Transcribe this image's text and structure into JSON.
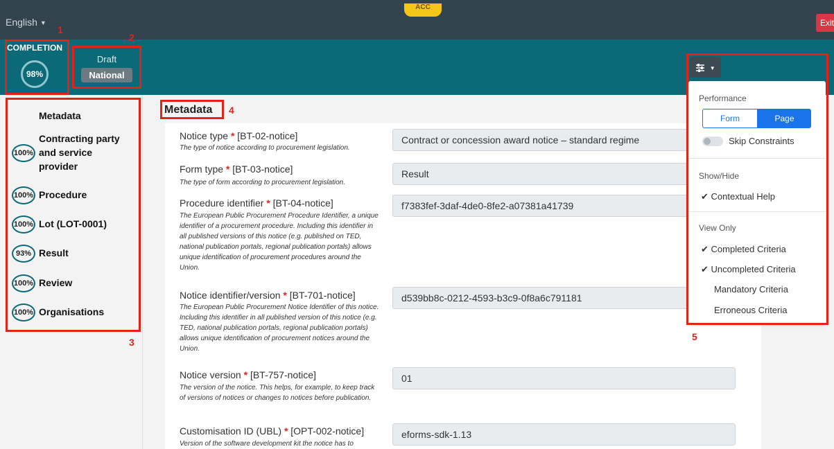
{
  "topbar": {
    "language": "English",
    "env_badge": "ACC",
    "exit_label": "Exit"
  },
  "header": {
    "completion_label": "COMPLETION",
    "completion_percent": "98%",
    "status": "Draft",
    "scope": "National"
  },
  "sections": [
    {
      "label": "Metadata",
      "percent": ""
    },
    {
      "label": "Contracting party and service provider",
      "percent": "100%"
    },
    {
      "label": "Procedure",
      "percent": "100%"
    },
    {
      "label": "Lot (LOT-0001)",
      "percent": "100%"
    },
    {
      "label": "Result",
      "percent": "93%"
    },
    {
      "label": "Review",
      "percent": "100%"
    },
    {
      "label": "Organisations",
      "percent": "100%"
    }
  ],
  "main": {
    "title": "Metadata",
    "fields": [
      {
        "label": "Notice type",
        "code": "[BT-02-notice]",
        "help": "The type of notice according to procurement legislation.",
        "value": "Contract or concession award notice – standard regime"
      },
      {
        "label": "Form type",
        "code": "[BT-03-notice]",
        "help": "The type of form according to procurement legislation.",
        "value": "Result"
      },
      {
        "label": "Procedure identifier",
        "code": "[BT-04-notice]",
        "help": "The European Public Procurement Procedure Identifier, a unique identifier of a procurement procedure. Including this identifier in all published versions of this notice (e.g. published on TED, national publication portals, regional publication portals) allows unique identification of procurement procedures around the Union.",
        "value": "f7383fef-3daf-4de0-8fe2-a07381a41739"
      },
      {
        "label": "Notice identifier/version",
        "code": "[BT-701-notice]",
        "help": "The European Public Procurement Notice Identifier of this notice. Including this identifier in all published version of this notice (e.g. TED, national publication portals, regional publication portals) allows unique identification of procurement notices around the Union.",
        "value": "d539bb8c-0212-4593-b3c9-0f8a6c791181"
      },
      {
        "label": "Notice version",
        "code": "[BT-757-notice]",
        "help": "The version of the notice. This helps, for example, to keep track of versions of notices or changes to notices before publication.",
        "value": "01"
      },
      {
        "label": "Customisation ID (UBL)",
        "code": "[OPT-002-notice]",
        "help": "Version of the software development kit the notice has to",
        "value": "eforms-sdk-1.13"
      }
    ]
  },
  "settings_menu": {
    "performance_heading": "Performance",
    "form_label": "Form",
    "page_label": "Page",
    "skip_constraints": "Skip Constraints",
    "show_hide_heading": "Show/Hide",
    "contextual_help": "Contextual Help",
    "view_only_heading": "View Only",
    "completed_criteria": "Completed Criteria",
    "uncompleted_criteria": "Uncompleted Criteria",
    "mandatory_criteria": "Mandatory Criteria",
    "erroneous_criteria": "Erroneous Criteria",
    "check_mark": "✔"
  },
  "annotations": [
    "1",
    "2",
    "3",
    "4",
    "5"
  ],
  "colors": {
    "topbar": "#33434d",
    "teal": "#0c6a78",
    "accent": "#1a73e8",
    "annotation": "#e2231a"
  }
}
